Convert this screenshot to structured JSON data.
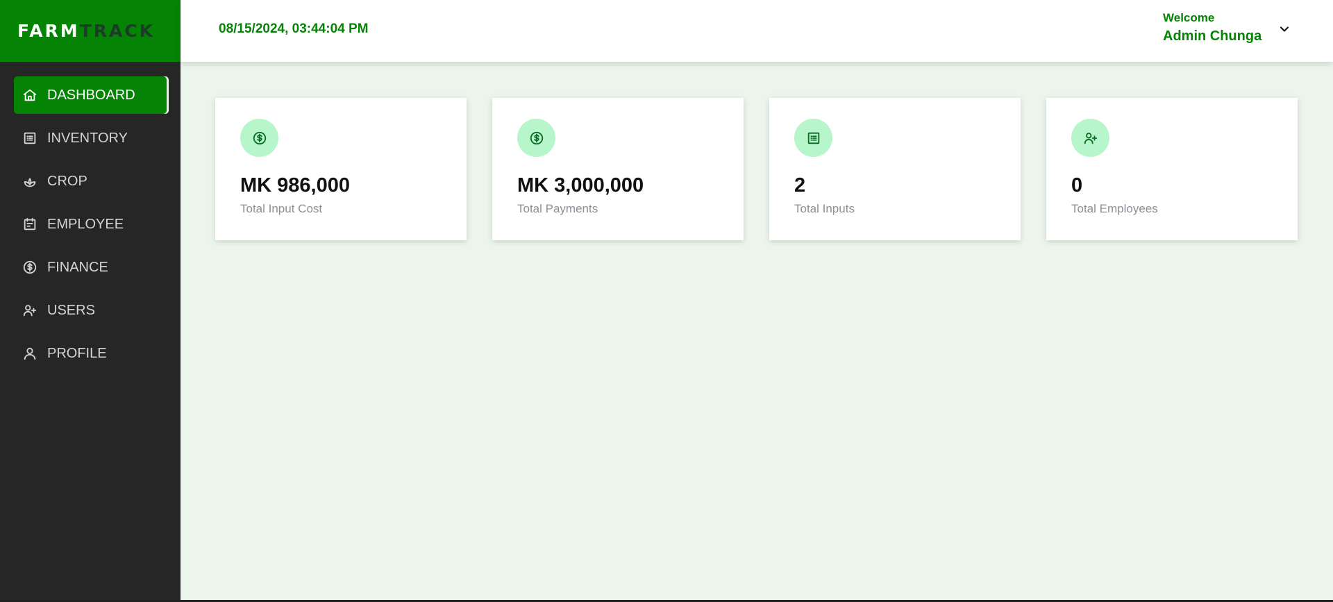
{
  "brand": {
    "part1": "FARM",
    "part2": "TRACK"
  },
  "header": {
    "datetime": "08/15/2024, 03:44:04 PM",
    "welcome": "Welcome",
    "user_name": "Admin Chunga"
  },
  "sidebar": {
    "items": [
      {
        "label": "DASHBOARD",
        "icon": "home-icon",
        "active": true
      },
      {
        "label": "INVENTORY",
        "icon": "list-icon"
      },
      {
        "label": "CROP",
        "icon": "sprout-icon"
      },
      {
        "label": "EMPLOYEE",
        "icon": "calendar-icon"
      },
      {
        "label": "FINANCE",
        "icon": "dollar-circle-icon"
      },
      {
        "label": "USERS",
        "icon": "user-plus-icon"
      },
      {
        "label": "PROFILE",
        "icon": "user-icon"
      }
    ]
  },
  "cards": [
    {
      "value": "MK 986,000",
      "label": "Total Input Cost",
      "icon": "dollar-circle-icon"
    },
    {
      "value": "MK 3,000,000",
      "label": "Total Payments",
      "icon": "dollar-circle-icon"
    },
    {
      "value": "2",
      "label": "Total Inputs",
      "icon": "list-icon"
    },
    {
      "value": "0",
      "label": "Total Employees",
      "icon": "user-plus-icon"
    }
  ],
  "colors": {
    "brand_green": "#058305",
    "sidebar_bg": "#262626",
    "main_bg": "#ebf5ec",
    "icon_circle": "#b7f5cb",
    "logo_dark": "#1e3b2a"
  }
}
